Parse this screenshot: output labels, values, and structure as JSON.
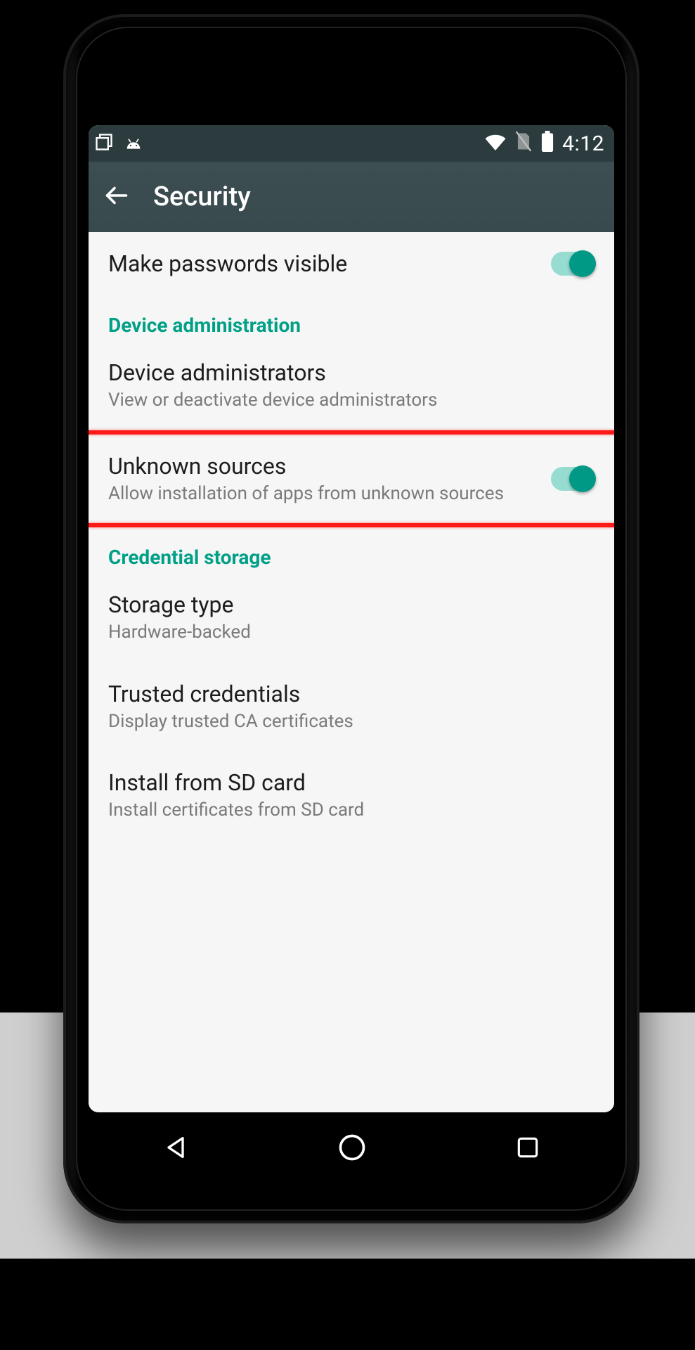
{
  "statusbar": {
    "time": "4:12"
  },
  "appbar": {
    "title": "Security"
  },
  "rows": {
    "passwords": {
      "title": "Make passwords visible"
    },
    "section_device_admin": "Device administration",
    "device_admins": {
      "title": "Device administrators",
      "sub": "View or deactivate device administrators"
    },
    "unknown_sources": {
      "title": "Unknown sources",
      "sub": "Allow installation of apps from unknown sources"
    },
    "section_credential": "Credential storage",
    "storage_type": {
      "title": "Storage type",
      "sub": "Hardware-backed"
    },
    "trusted": {
      "title": "Trusted credentials",
      "sub": "Display trusted CA certificates"
    },
    "sdcard": {
      "title": "Install from SD card",
      "sub": "Install certificates from SD card"
    }
  }
}
